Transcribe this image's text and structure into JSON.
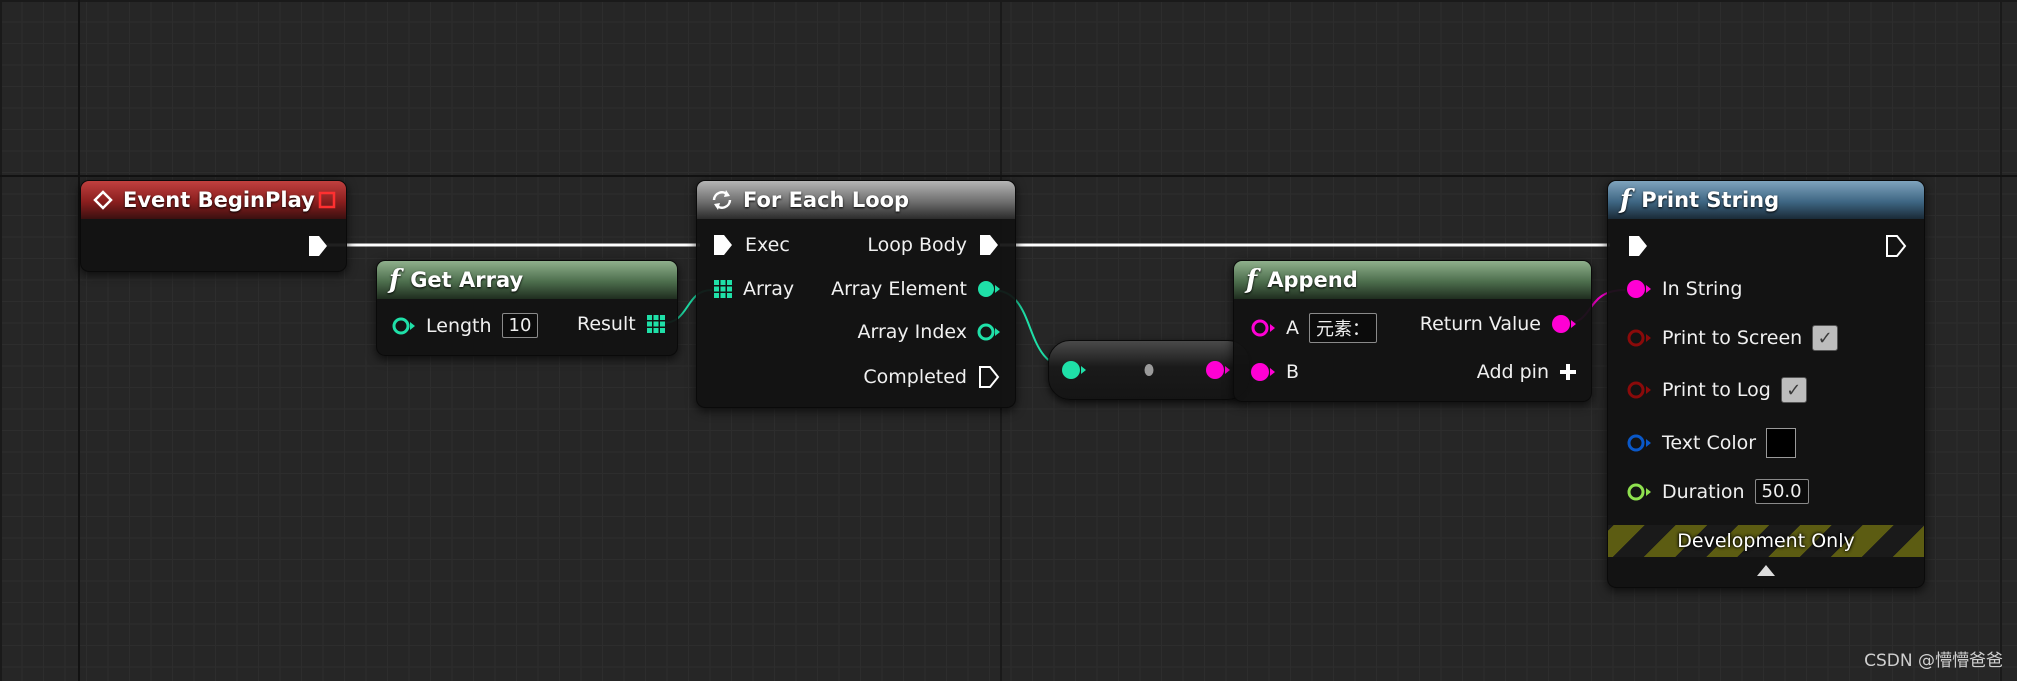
{
  "nodes": {
    "event_begin_play": {
      "title": "Event BeginPlay"
    },
    "get_array": {
      "title": "Get Array",
      "length_label": "Length",
      "length_value": "10",
      "result_label": "Result"
    },
    "for_each_loop": {
      "title": "For Each Loop",
      "exec_label": "Exec",
      "array_label": "Array",
      "loop_body_label": "Loop Body",
      "array_element_label": "Array Element",
      "array_index_label": "Array Index",
      "completed_label": "Completed"
    },
    "append": {
      "title": "Append",
      "a_label": "A",
      "a_value": "元素：",
      "b_label": "B",
      "return_value_label": "Return Value",
      "add_pin_label": "Add pin"
    },
    "print_string": {
      "title": "Print String",
      "in_string_label": "In String",
      "print_to_screen_label": "Print to Screen",
      "print_to_log_label": "Print to Log",
      "text_color_label": "Text Color",
      "duration_label": "Duration",
      "duration_value": "50.0",
      "development_only_label": "Development Only"
    }
  },
  "colors": {
    "exec": "#ffffff",
    "integer": "#1fe0a8",
    "string": "#ff00d4",
    "boolean": "#8a0a0a",
    "struct": "#0a58c8",
    "float": "#8fe04f"
  },
  "watermark": "CSDN @懵懵爸爸"
}
